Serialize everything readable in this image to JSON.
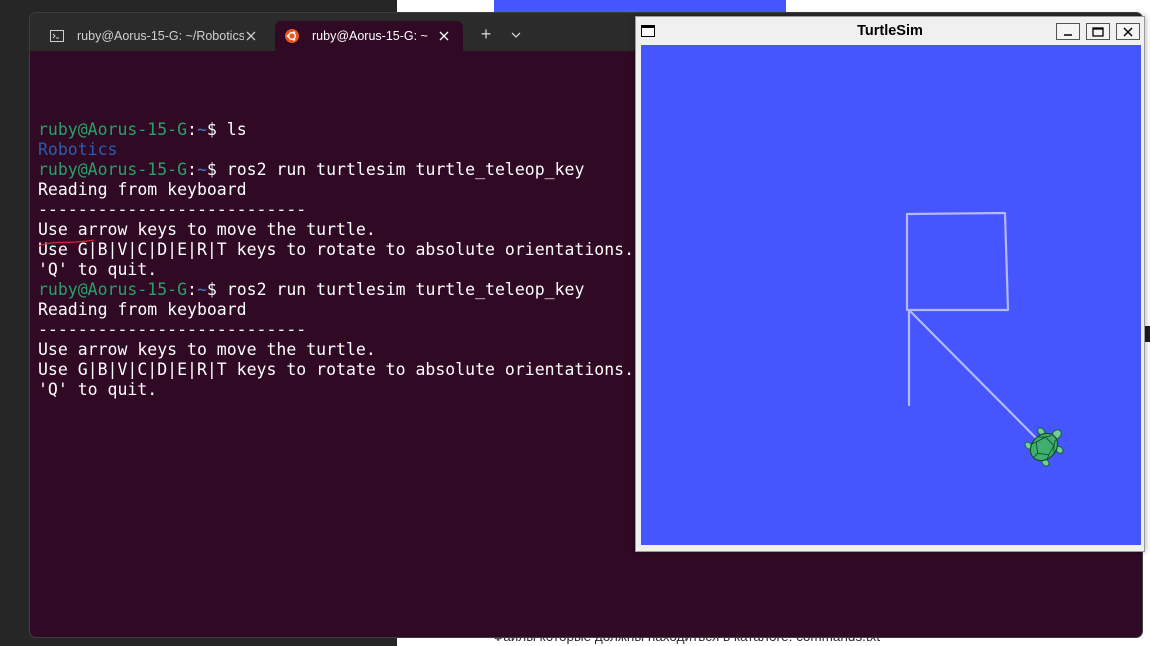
{
  "background_document": {
    "footer_text": "Файлы которые должны находиться в каталоге: commands.txt"
  },
  "terminal": {
    "tabs": [
      {
        "label": "ruby@Aorus-15-G: ~/Robotics",
        "icon": "terminal-icon",
        "active": false
      },
      {
        "label": "ruby@Aorus-15-G: ~",
        "icon": "ubuntu-icon",
        "active": true
      }
    ],
    "new_tab_label": "+",
    "prompt": {
      "user_host": "ruby@Aorus-15-G",
      "separator": ":",
      "path": "~",
      "symbol": "$ "
    },
    "lines": [
      {
        "kind": "prompt",
        "command": "ls"
      },
      {
        "kind": "dir",
        "text": "Robotics"
      },
      {
        "kind": "prompt",
        "command": "ros2 run turtlesim turtle_teleop_key"
      },
      {
        "kind": "text",
        "text": "Reading from keyboard"
      },
      {
        "kind": "text",
        "text": "---------------------------"
      },
      {
        "kind": "text",
        "text": "Use arrow keys to move the turtle."
      },
      {
        "kind": "text",
        "text": "Use G|B|V|C|D|E|R|T keys to rotate to absolute orientations. F to cancel a rotation."
      },
      {
        "kind": "text",
        "text": "'Q' to quit."
      },
      {
        "kind": "prompt",
        "command": "ros2 run turtlesim turtle_teleop_key"
      },
      {
        "kind": "text",
        "text": "Reading from keyboard"
      },
      {
        "kind": "text",
        "text": "---------------------------"
      },
      {
        "kind": "text",
        "text": "Use arrow keys to move the turtle."
      },
      {
        "kind": "text",
        "text": "Use G|B|V|C|D|E|R|T keys to rotate to absolute orientations. F to cancel a rotation."
      },
      {
        "kind": "text",
        "text": "'Q' to quit."
      }
    ],
    "colors": {
      "background": "#300a24",
      "user_host": "#26a269",
      "path": "#4a78d0"
    }
  },
  "turtlesim": {
    "title": "TurtleSim",
    "canvas_color": "#4556ff",
    "pen_color": "#b3b8ff",
    "turtle_icon": "turtle-icon"
  }
}
